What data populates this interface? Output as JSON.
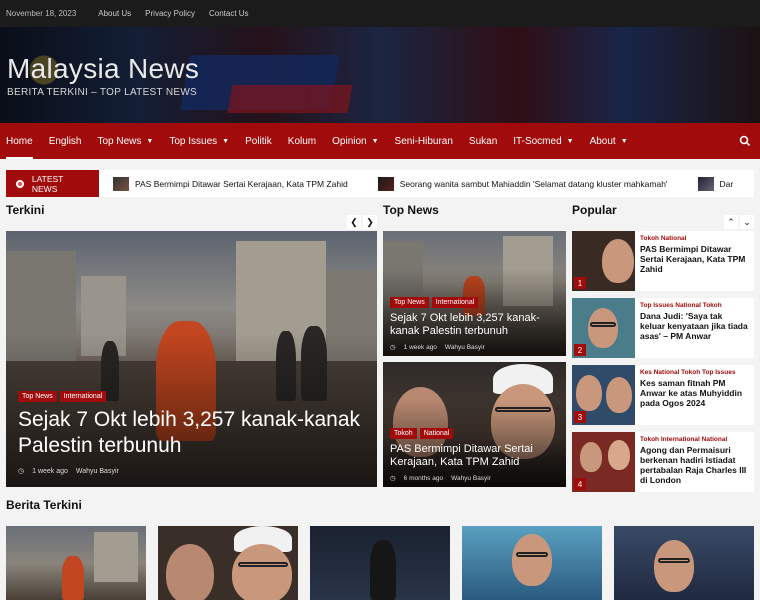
{
  "topbar": {
    "date": "November 18, 2023",
    "links": [
      "About Us",
      "Privacy Policy",
      "Contact Us"
    ]
  },
  "site": {
    "title": "Malaysia News",
    "tagline": "BERITA TERKINI – TOP LATEST NEWS"
  },
  "nav": {
    "items": [
      "Home",
      "English",
      "Top News",
      "Top Issues",
      "Politik",
      "Kolum",
      "Opinion",
      "Seni-Hiburan",
      "Sukan",
      "IT-Socmed",
      "About"
    ]
  },
  "ticker": {
    "label": "LATEST NEWS",
    "items": [
      "PAS Bermimpi Ditawar Sertai Kerajaan, Kata TPM Zahid",
      "Seorang wanita sambut Mahiaddin 'Selamat datang kluster mahkamah'",
      "Dar"
    ]
  },
  "terkini": {
    "title": "Terkini",
    "hero": {
      "cats": [
        "Top News",
        "International"
      ],
      "headline": "Sejak 7 Okt lebih 3,257 kanak-kanak Palestin terbunuh",
      "time": "1 week ago",
      "author": "Wahyu Basyir"
    }
  },
  "topnews": {
    "title": "Top News",
    "cards": [
      {
        "cats": [
          "Top News",
          "International"
        ],
        "headline": "Sejak 7 Okt lebih 3,257 kanak-kanak Palestin terbunuh",
        "time": "1 week ago",
        "author": "Wahyu Basyir"
      },
      {
        "cats": [
          "Tokoh",
          "National"
        ],
        "headline": "PAS Bermimpi Ditawar Sertai Kerajaan, Kata TPM Zahid",
        "time": "6 months ago",
        "author": "Wahyu Basyir"
      }
    ]
  },
  "popular": {
    "title": "Popular",
    "items": [
      {
        "num": "1",
        "cats": "Tokoh National",
        "title": "PAS Bermimpi Ditawar Sertai Kerajaan, Kata TPM Zahid"
      },
      {
        "num": "2",
        "cats": "Top Issues National Tokoh",
        "title": "Dana Judi: 'Saya tak keluar kenyataan jika tiada asas' – PM Anwar"
      },
      {
        "num": "3",
        "cats": "Kes National Tokoh Top Issues",
        "title": "Kes saman fitnah PM Anwar ke atas Muhyiddin pada Ogos 2024"
      },
      {
        "num": "4",
        "cats": "Tokoh International National",
        "title": "Agong dan Permaisuri berkenan hadiri Istiadat pertabalan Raja Charles III di London"
      }
    ]
  },
  "berita": {
    "title": "Berita Terkini"
  },
  "icons": {
    "search": "search-icon",
    "prev": "chevron-left-icon",
    "next": "chevron-right-icon",
    "up": "chevron-up-icon",
    "down": "chevron-down-icon",
    "clock": "clock-icon",
    "user": "user-icon"
  },
  "colors": {
    "brand": "#a10b0b",
    "topbar": "#1b1b1b"
  }
}
